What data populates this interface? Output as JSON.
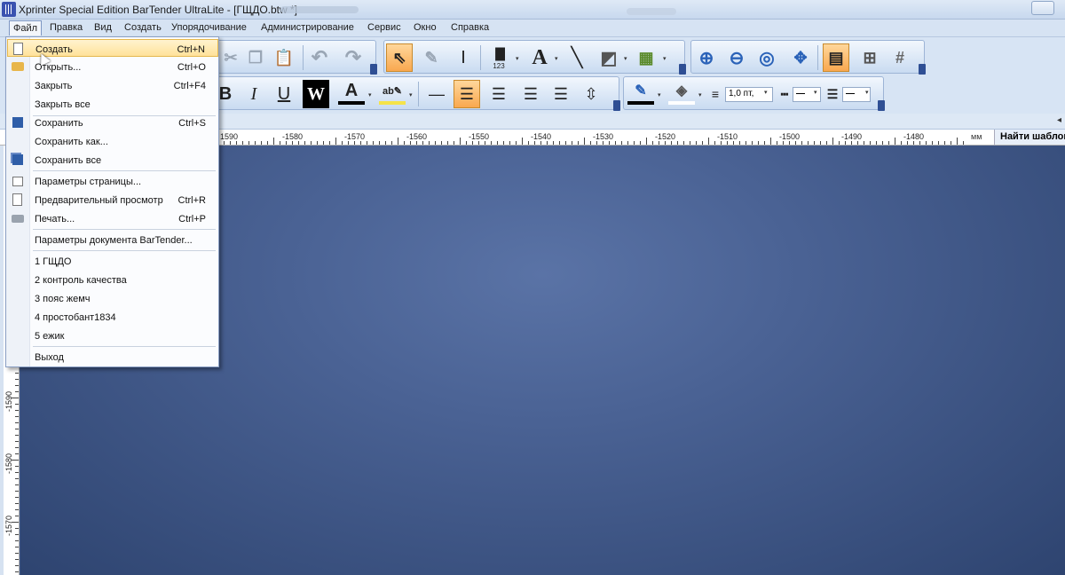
{
  "window": {
    "title": "Xprinter Special Edition BarTender UltraLite - [ГЩДО.btw *]"
  },
  "menubar": {
    "items": [
      "Файл",
      "Правка",
      "Вид",
      "Создать",
      "Упорядочивание",
      "Администрирование",
      "Сервис",
      "Окно",
      "Справка"
    ]
  },
  "file_menu": {
    "create": {
      "label": "Создать",
      "shortcut": "Ctrl+N"
    },
    "open": {
      "label": "Открыть...",
      "shortcut": "Ctrl+O"
    },
    "close": {
      "label": "Закрыть",
      "shortcut": "Ctrl+F4"
    },
    "close_all": {
      "label": "Закрыть все"
    },
    "save": {
      "label": "Сохранить",
      "shortcut": "Ctrl+S"
    },
    "save_as": {
      "label": "Сохранить как..."
    },
    "save_all": {
      "label": "Сохранить все"
    },
    "page_setup": {
      "label": "Параметры страницы..."
    },
    "print_preview": {
      "label": "Предварительный просмотр",
      "shortcut": "Ctrl+R"
    },
    "print": {
      "label": "Печать...",
      "shortcut": "Ctrl+P"
    },
    "doc_params": {
      "label": "Параметры документа BarTender..."
    },
    "recent": [
      "1 ГЩДО",
      "2 контроль качества",
      "3 пояс жемч",
      "4 простобант1834",
      "5 ежик"
    ],
    "exit": {
      "label": "Выход"
    }
  },
  "toolbar": {
    "barcode_caption": "123",
    "line_width": "1,0 пт,"
  },
  "ruler": {
    "labels": [
      "1590",
      "-1580",
      "-1570",
      "-1560",
      "-1550",
      "-1540",
      "-1530",
      "-1520",
      "-1510",
      "-1500",
      "-1490",
      "-1480"
    ],
    "unit": "мм"
  },
  "vruler": {
    "labels": [
      "-1590",
      "-1580",
      "-1570"
    ]
  },
  "find_panel": {
    "title": "Найти шаблон"
  },
  "colors": {
    "canvas": "#4a6294",
    "menu_highlight": "#ffe29a",
    "pressed_button": "#f9a84f"
  }
}
